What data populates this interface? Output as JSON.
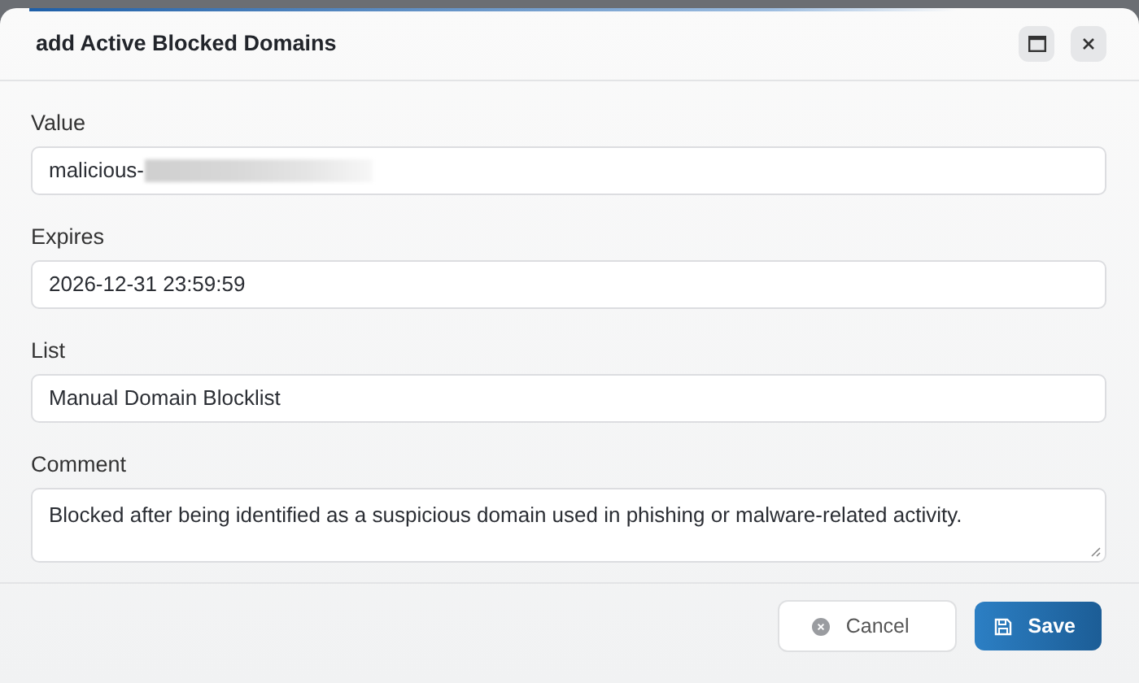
{
  "dialog": {
    "title": "add Active Blocked Domains"
  },
  "fields": [
    {
      "kind": "input",
      "label": "Value",
      "value": "malicious-",
      "redacted": true
    },
    {
      "kind": "input",
      "label": "Expires",
      "value": "2026-12-31 23:59:59"
    },
    {
      "kind": "input",
      "label": "List",
      "value": "Manual Domain Blocklist"
    },
    {
      "kind": "textarea",
      "label": "Comment",
      "value": "Blocked after being identified as a suspicious domain used in phishing or malware-related activity."
    }
  ],
  "buttons": [
    {
      "kind": "cancel",
      "label": "Cancel"
    },
    {
      "kind": "save",
      "label": "Save"
    }
  ]
}
